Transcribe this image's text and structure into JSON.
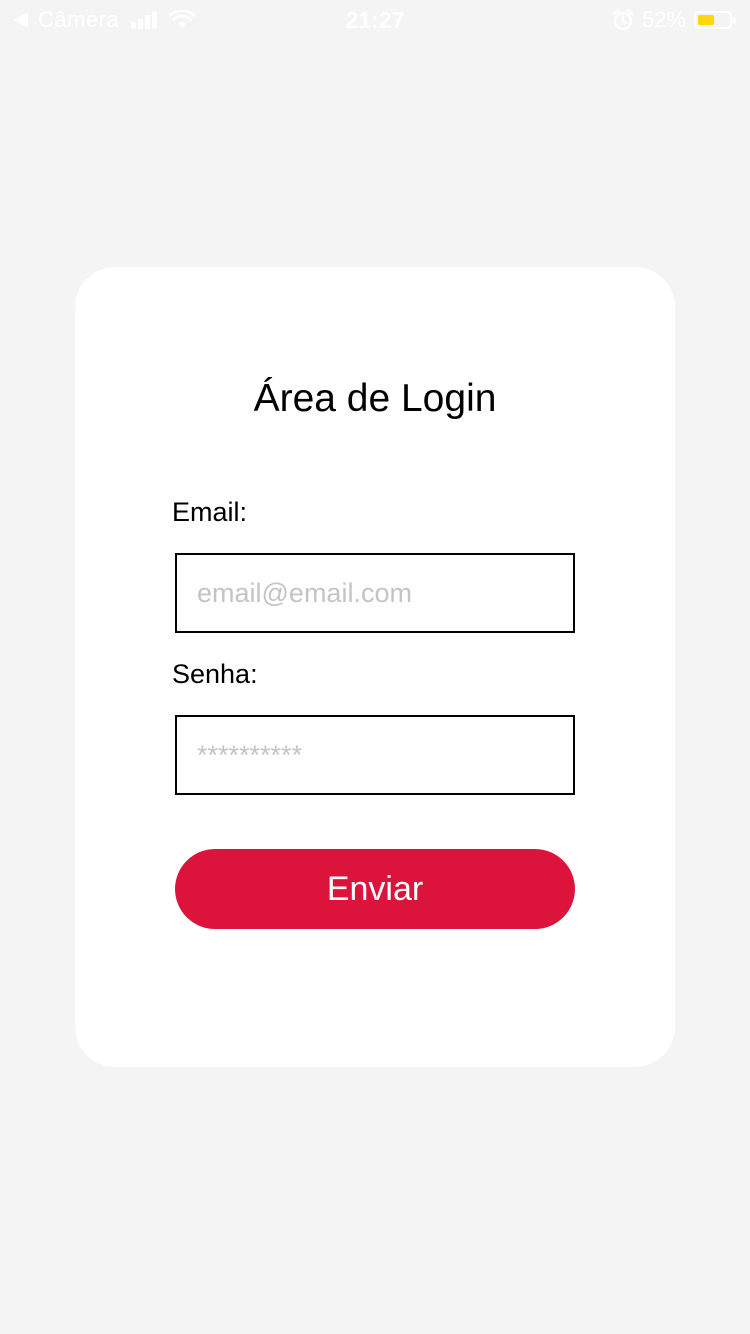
{
  "status_bar": {
    "back_label": "Câmera",
    "time": "21:27",
    "battery_percent": "52%",
    "battery_level": 0.52,
    "icons": [
      "back-arrow-icon",
      "signal-icon",
      "wifi-icon",
      "alarm-icon",
      "battery-icon"
    ]
  },
  "login": {
    "title": "Área de Login",
    "email_label": "Email:",
    "email_placeholder": "email@email.com",
    "email_value": "",
    "password_label": "Senha:",
    "password_placeholder": "**********",
    "password_value": "",
    "submit_label": "Enviar"
  },
  "colors": {
    "background": "#f4f4f4",
    "card": "#ffffff",
    "button": "#dc143c",
    "battery_fill": "#ffd60a",
    "placeholder": "#c4c4c4"
  }
}
